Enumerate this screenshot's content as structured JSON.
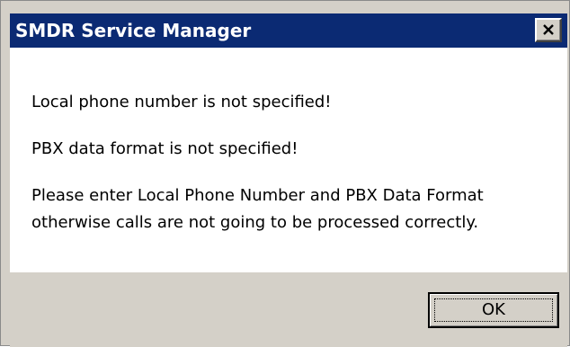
{
  "window": {
    "title": "SMDR Service Manager",
    "close_icon": "close-icon"
  },
  "messages": {
    "line1": "Local phone number is not specified!",
    "line2": "PBX data format is not specified!",
    "line3a": "Please enter Local Phone Number and PBX Data Format",
    "line3b": "otherwise calls are not going to be processed correctly."
  },
  "buttons": {
    "ok_label": "OK"
  },
  "colors": {
    "titlebar": "#0b2a73",
    "dialog_face": "#d4d0c8",
    "content_bg": "#ffffff"
  }
}
